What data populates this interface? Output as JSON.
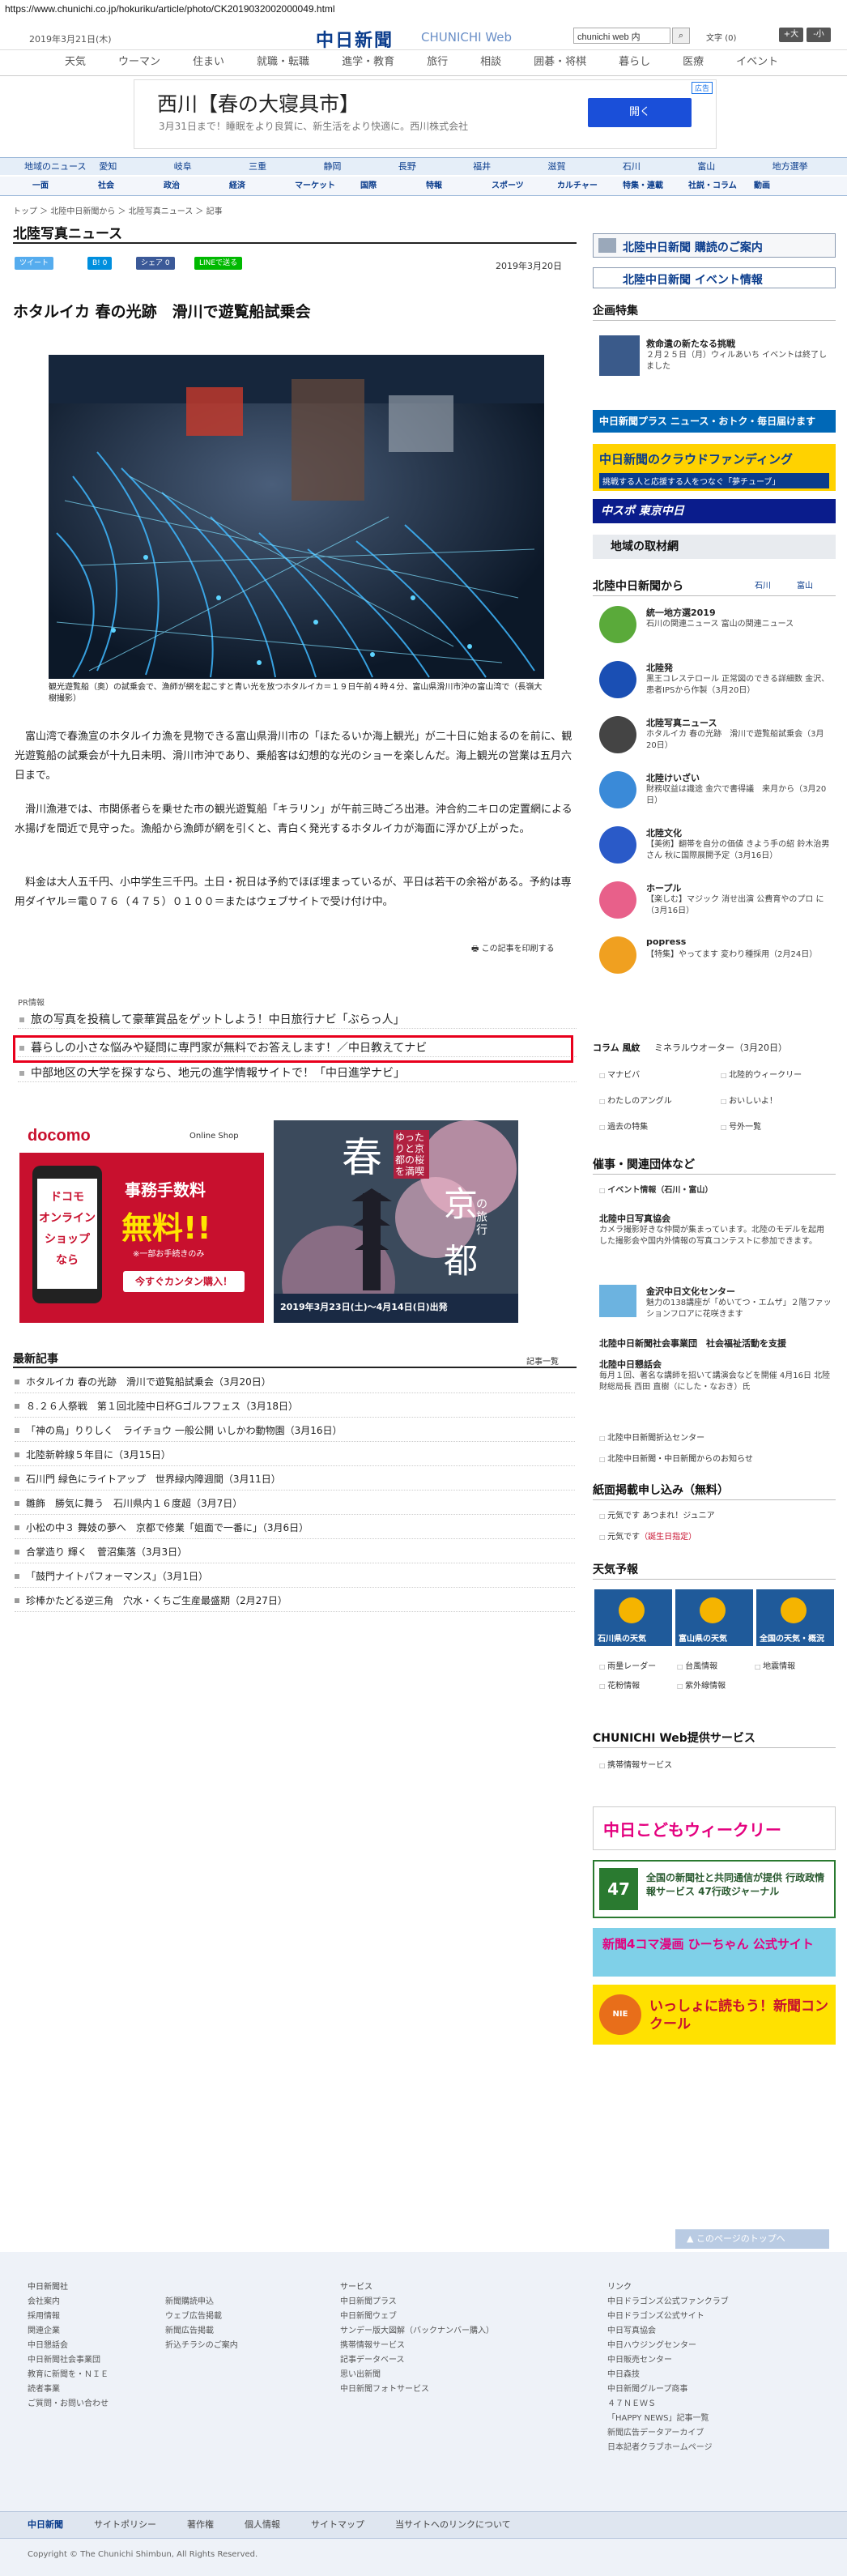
{
  "browser": {
    "url": "https://www.chunichi.co.jp/hokuriku/article/photo/CK2019032002000049.html"
  },
  "header": {
    "date": "2019年3月21日(木)",
    "logo_text": "中日新聞",
    "logo_sub": "CHUNICHI Web",
    "search_value": "chunichi web 内",
    "search_button": "検索",
    "font_size_label": "文字",
    "font_size_value": "(0)",
    "font_bigger": "+大",
    "font_smaller": "-小"
  },
  "top_nav": [
    "天気",
    "ウーマン",
    "住まい",
    "就職・転職",
    "進学・教育",
    "旅行",
    "相談",
    "囲碁・将棋",
    "暮らし",
    "医療",
    "イベント"
  ],
  "ad_banner": {
    "title": "西川【春の大寝具市】",
    "text": "3月31日まで！睡眠をより良質に、新生活をより快適に。西川株式会社",
    "button": "開く",
    "tag": "広告"
  },
  "category_nav": [
    "地域のニュース",
    "愛知",
    "岐阜",
    "三重",
    "静岡",
    "長野",
    "福井",
    "滋賀",
    "石川",
    "富山",
    "地方選挙"
  ],
  "sub_nav": [
    "一面",
    "社会",
    "政治",
    "経済",
    "マーケット",
    "国際",
    "特報",
    "スポーツ",
    "カルチャー",
    "特集・連載",
    "社説・コラム",
    "動画"
  ],
  "breadcrumb": "トップ ＞ 北陸中日新聞から ＞ 北陸写真ニュース ＞ 記事",
  "section_title": "北陸写真ニュース",
  "share": {
    "tweet": "ツイート",
    "hatena": "B! 0",
    "facebook": "シェア 0",
    "line": "LINEで送る"
  },
  "article": {
    "date": "2019年3月20日",
    "headline": "ホタルイカ 春の光跡　滑川で遊覧船試乗会",
    "caption": "観光遊覧船（奥）の試乗会で、漁師が網を起こすと青い光を放つホタルイカ＝１９日午前４時４分、富山県滑川市沖の富山湾で（長嶺大樹撮影）",
    "paragraphs": [
      "富山湾で春漁宣のホタルイカ漁を見物できる富山県滑川市の「ほたるいか海上観光」が二十日に始まるのを前に、観光遊覧船の試乗会が十九日未明、滑川市沖であり、乗船客は幻想的な光のショーを楽しんだ。海上観光の営業は五月六日まで。",
      "滑川漁港では、市関係者らを乗せた市の観光遊覧船「キラリン」が午前三時ごろ出港。沖合約二キロの定置網による水揚げを間近で見守った。漁船から漁師が網を引くと、青白く発光するホタルイカが海面に浮かび上がった。",
      "料金は大人五千円、小中学生三千円。土日・祝日は予約でほぼ埋まっているが、平日は若干の余裕がある。予約は専用ダイヤル＝電０７６（４７５）０１００＝またはウェブサイトで受け付け中。"
    ],
    "print_label": "この記事を印刷する"
  },
  "pr": {
    "label": "PR情報",
    "items": [
      "旅の写真を投稿して豪華賞品をゲットしよう！中日旅行ナビ「ぶらっ人」",
      "暮らしの小さな悩みや疑問に専門家が無料でお答えします！／中日教えてナビ",
      "中部地区の大学を探すなら、地元の進学情報サイトで！「中日進学ナビ」"
    ]
  },
  "ads": {
    "docomo": {
      "brand": "docomo",
      "shop": "Online Shop",
      "box1": "ドコモ",
      "box2": "オンライン",
      "box3": "ショップ",
      "box4": "なら",
      "fee": "事務手数料",
      "free": "無料!!",
      "note": "※一部お手続きのみ",
      "cta": "今すぐカンタン購入！"
    },
    "kyoto": {
      "spring": "春",
      "kyo": "京",
      "miyako": "都",
      "travel": "の旅行",
      "dates": "2019年3月23日(土)〜4月14日(日)出発",
      "badge": "ゆったりと京都の桜を満喫"
    }
  },
  "latest": {
    "title": "最新記事",
    "more": "記事一覧",
    "items": [
      "ホタルイカ 春の光跡　滑川で遊覧船試乗会（3月20日）",
      "８.２６人祭戦　第１回北陸中日杯Gゴルフフェス（3月18日）",
      "「神の鳥」りりしく　ライチョウ 一般公開 いしかわ動物園（3月16日）",
      "北陸新幹線５年目に（3月15日）",
      "石川門 緑色にライトアップ　世界緑内障週間（3月11日）",
      "雛飾　勝気に舞う　石川県内１６度超（3月7日）",
      "小松の中３ 舞妓の夢へ　京都で修業「姐面で一番に」（3月6日）",
      "合掌造り 輝く　菅沼集落（3月3日）",
      "「鼓門ナイトパフォーマンス」（3月1日）",
      "珍棒かたどる逆三角　穴水・くちご生産最盛期（2月27日）"
    ]
  },
  "sidebar": {
    "subscribe": "北陸中日新聞 購読のご案内",
    "event": "北陸中日新聞 イベント情報",
    "kikaku": {
      "title": "企画特集",
      "item_title": "救命遺の新たなる挑戦",
      "item_text": "２月２５日（月）ウィルあいち イベントは終了しました"
    },
    "plus": "中日新聞プラス ニュース・おトク・毎日届けます",
    "crowdfunding": "中日新聞のクラウドファンディング",
    "crowdfunding_sub": "挑戦する人と応援する人をつなぐ「夢チューブ」",
    "chuspo": "中スポ 東京中日",
    "chiiki": "地域の取材網",
    "hokuriku_from": "北陸中日新聞から",
    "hokuriku_tabs": [
      "石川",
      "富山"
    ],
    "items": [
      {
        "title": "統一地方選2019",
        "text": "石川の関連ニュース 富山の関連ニュース"
      },
      {
        "title": "北陸発",
        "text": "黒王コレステロール 正常図のできる詳細数 金沢、患者IPSから作製（3月20日）"
      },
      {
        "title": "北陸写真ニュース",
        "text": "ホタルイカ 春の光跡　滑川で遊覧船試乗会（3月20日）"
      },
      {
        "title": "北陸けいざい",
        "text": "財務収益は識途 金穴で書得議　来月から（3月20日）"
      },
      {
        "title": "北陸文化",
        "text": "【美術】翻帯を自分の価値 きよう手の紹 鈴木治男さん 秋に国際展開予定（3月16日）"
      },
      {
        "title": "ホープル",
        "text": "【楽しむ】マジック 消せ出演 公費育やのプロ に（3月16日）"
      },
      {
        "title": "popress",
        "text": "【特集】やってます 変わり種採用（2月24日）"
      }
    ],
    "column_label": "コラム 風紋",
    "column_text": "ミネラルウオーター（3月20日）",
    "links_a": [
      "マナビバ",
      "北陸的ウィークリー",
      "わたしのアングル",
      "おいしいよ！",
      "過去の特集",
      "号外一覧"
    ],
    "events": {
      "title": "催事・関連団体など",
      "sub": "イベント情報（石川・富山）",
      "photo_title": "北陸中日写真協会",
      "photo_text": "カメラ撮影好きな仲間が集まっています。北陸のモデルを起用した撮影会や国内外情報の写真コンテストに参加できます。",
      "kanazawa_title": "金沢中日文化センター",
      "kanazawa_text": "魅力の138講座が「めいてつ・エムザ」２階ファッションフロアに花咲きます",
      "donation": "北陸中日新聞社会事業団　社会福祉活動を支援",
      "kondan_title": "北陸中日懇話会",
      "kondan_text": "毎月１回、著名な講師を招いて講演会などを開催 4月16日 北陸財総局長 西田 直樹（にした・なおき）氏",
      "link1": "北陸中日新聞折込センター",
      "link2": "北陸中日新聞・中日新聞からのお知らせ"
    },
    "shimen": {
      "title": "紙面掲載申し込み（無料）",
      "l1": "元気です あつまれ！ジュニア",
      "l2": "元気です",
      "l2_red": "（誕生日指定）"
    },
    "weather": {
      "title": "天気予報",
      "tiles": [
        "石川県の天気",
        "富山県の天気",
        "全国の天気・概況"
      ],
      "links": [
        "雨量レーダー",
        "台風情報",
        "地震情報",
        "花粉情報",
        "紫外線情報"
      ]
    },
    "service": {
      "title": "CHUNICHI Web提供サービス",
      "link": "携帯情報サービス"
    },
    "banners": {
      "kodomo": "中日こどもウィークリー",
      "gyosei": "全国の新聞社と共同通信が提供 行政政情報サービス 47行政ジャーナル",
      "hichan": "新聞4コマ漫画 ひーちゃん 公式サイト",
      "niconcours": "いっしょに読もう！新聞コンクール"
    }
  },
  "footer": {
    "to_top": "このページのトップへ",
    "col1_title": "中日新聞社",
    "col1": [
      "会社案内",
      "採用情報",
      "関連企業",
      "中日懇話会",
      "中日新聞社会事業団",
      "教育に新聞を・ＮＩＥ",
      "読者事業",
      "ご質問・お問い合わせ"
    ],
    "col2": [
      "新聞購読申込",
      "ウェブ広告掲載",
      "新聞広告掲載",
      "折込チラシのご案内"
    ],
    "col3_title": "サービス",
    "col3": [
      "中日新聞プラス",
      "中日新聞ウェブ",
      "サンデー版大図解（バックナンバー購入）",
      "携帯情報サービス",
      "記事データベース",
      "思い出新聞",
      "中日新聞フォトサービス"
    ],
    "col4_title": "リンク",
    "col4": [
      "中日ドラゴンズ公式ファンクラブ",
      "中日ドラゴンズ公式サイト",
      "中日写真協会",
      "中日ハウジングセンター",
      "中日販売センター",
      "中日森技",
      "中日新聞グループ商事",
      "４７ＮＥＷＳ",
      "「HAPPY NEWS」記事一覧",
      "新聞広告データアーカイブ",
      "日本記者クラブホームページ"
    ],
    "nav": [
      "中日新聞",
      "サイトポリシー",
      "著作権",
      "個人情報",
      "サイトマップ",
      "当サイトへのリンクについて"
    ],
    "copyright": "Copyright © The Chunichi Shimbun, All Rights Reserved."
  },
  "colors": {
    "brand": "#0a3c8c",
    "highlight": "#e8001c",
    "link_blue": "#1a4fd9"
  }
}
